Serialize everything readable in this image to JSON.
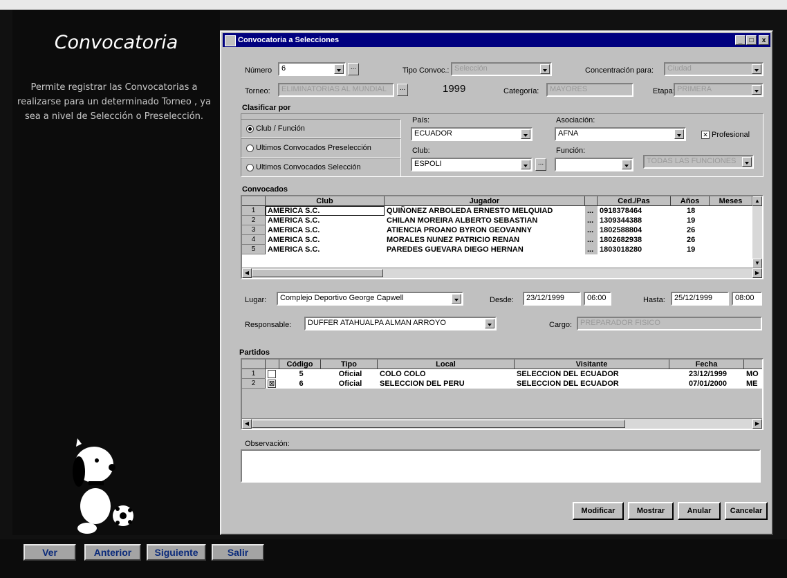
{
  "side": {
    "title": "Convocatoria",
    "description": "Permite registrar las Convocatorias a realizarse para un determinado Torneo , ya sea a nivel de Selección o Preselección.",
    "buttons": {
      "ver": "Ver",
      "anterior": "Anterior",
      "siguiente": "Siguiente",
      "salir": "Salir"
    }
  },
  "window": {
    "title": "Convocatoria a Selecciones",
    "controls": {
      "minimize": "_",
      "maximize": "□",
      "close": "x"
    }
  },
  "form": {
    "numero_label": "Número",
    "numero_value": "6",
    "tipo_label": "Tipo Convoc.:",
    "tipo_value": "Selección",
    "concentracion_label": "Concentración para:",
    "concentracion_value": "Ciudad",
    "torneo_label": "Torneo:",
    "torneo_value": "ELIMINATORIAS AL MUNDIAL",
    "year": "1999",
    "categoria_label": "Categoría:",
    "categoria_value": "MAYORES",
    "etapa_label": "Etapa:",
    "etapa_value": "PRIMERA"
  },
  "clasificar": {
    "title": "Clasificar por",
    "options": [
      "Club / Función",
      "Ultimos Convocados Preselección",
      "Ultimos Convocados Selección"
    ],
    "pais_label": "País:",
    "pais_value": "ECUADOR",
    "asociacion_label": "Asociación:",
    "asociacion_value": "AFNA",
    "profesional_label": "Profesional",
    "club_label": "Club:",
    "club_value": "ESPOLI",
    "funcion_label": "Función:",
    "funcion_value": "",
    "extra_value": "TODAS LAS FUNCIONES"
  },
  "convocados": {
    "title": "Convocados",
    "headers": [
      "Club",
      "Jugador",
      "Ced./Pas",
      "Años",
      "Meses"
    ],
    "rows": [
      {
        "n": "1",
        "club": "AMERICA S.C.",
        "jugador": "QUIÑONEZ ARBOLEDA ERNESTO MELQUIAD",
        "ced": "0918378464",
        "anos": "18"
      },
      {
        "n": "2",
        "club": "AMERICA S.C.",
        "jugador": "CHILAN MOREIRA ALBERTO SEBASTIAN",
        "ced": "1309344388",
        "anos": "19"
      },
      {
        "n": "3",
        "club": "AMERICA S.C.",
        "jugador": "ATIENCIA PROANO BYRON GEOVANNY",
        "ced": "1802588804",
        "anos": "26"
      },
      {
        "n": "4",
        "club": "AMERICA S.C.",
        "jugador": "MORALES NUNEZ PATRICIO RENAN",
        "ced": "1802682938",
        "anos": "26"
      },
      {
        "n": "5",
        "club": "AMERICA S.C.",
        "jugador": "PAREDES GUEVARA DIEGO HERNAN",
        "ced": "1803018280",
        "anos": "19"
      }
    ]
  },
  "lugar": {
    "lugar_label": "Lugar:",
    "lugar_value": "Complejo Deportivo George Capwell",
    "desde_label": "Desde:",
    "desde_date": "23/12/1999",
    "desde_time": "06:00",
    "hasta_label": "Hasta:",
    "hasta_date": "25/12/1999",
    "hasta_time": "08:00",
    "responsable_label": "Responsable:",
    "responsable_value": "DUFFER ATAHUALPA ALMAN ARROYO",
    "cargo_label": "Cargo:",
    "cargo_value": "PREPARADOR FISICO"
  },
  "partidos": {
    "title": "Partidos",
    "headers": [
      "Código",
      "Tipo",
      "Local",
      "Visitante",
      "Fecha"
    ],
    "rows": [
      {
        "n": "1",
        "check": "",
        "codigo": "5",
        "tipo": "Oficial",
        "local": "COLO COLO",
        "visitante": "SELECCION DEL ECUADOR",
        "fecha": "23/12/1999",
        "extra": "MO"
      },
      {
        "n": "2",
        "check": "☒",
        "codigo": "6",
        "tipo": "Oficial",
        "local": "SELECCION DEL PERU",
        "visitante": "SELECCION DEL ECUADOR",
        "fecha": "07/01/2000",
        "extra": "ME"
      }
    ]
  },
  "observacion_label": "Observación:",
  "actions": {
    "modificar": "Modificar",
    "mostrar": "Mostrar",
    "anular": "Anular",
    "cancelar": "Cancelar"
  },
  "icons": {
    "dropdown": "chevron-down-icon",
    "ellipsis": "ellipsis-icon",
    "mascot": "snoopy-mascot"
  }
}
